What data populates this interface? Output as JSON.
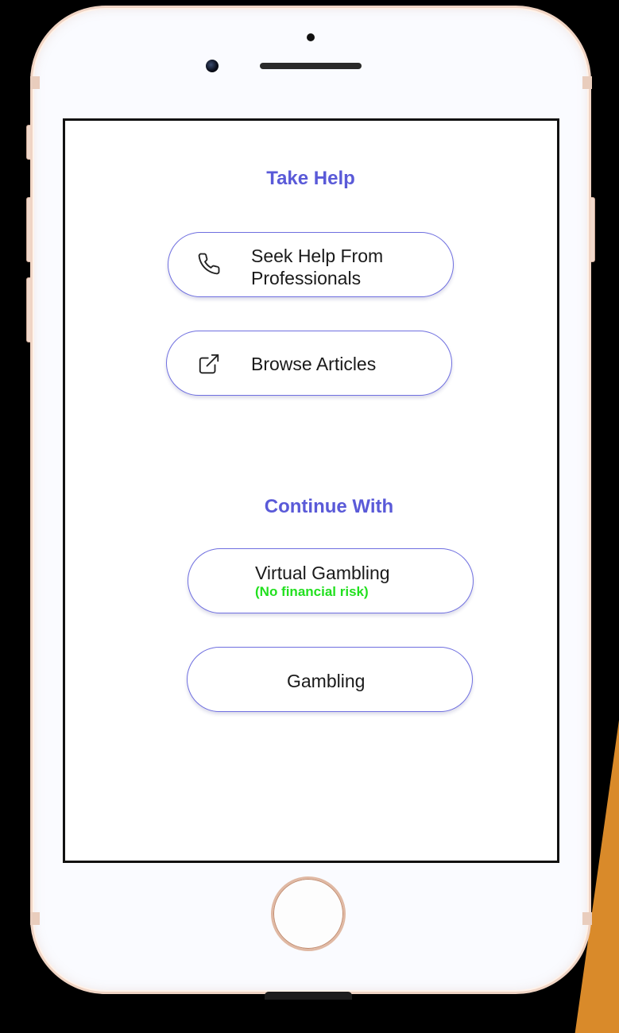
{
  "take_help": {
    "title": "Take Help",
    "buttons": [
      {
        "label": "Seek Help From Professionals",
        "icon": "phone-icon"
      },
      {
        "label": "Browse Articles",
        "icon": "external-link-icon"
      }
    ]
  },
  "continue_with": {
    "title": "Continue With",
    "buttons": [
      {
        "label": "Virtual Gambling",
        "sub_label": "(No financial risk)"
      },
      {
        "label": "Gambling"
      }
    ]
  },
  "colors": {
    "accent": "#5a5ad8",
    "button_border": "#6f6fe0",
    "safe_green": "#22e01f",
    "decor_orange": "#d98a2a"
  }
}
